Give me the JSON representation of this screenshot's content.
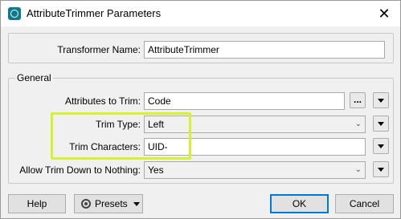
{
  "window": {
    "title": "AttributeTrimmer Parameters",
    "close_glyph": "✕"
  },
  "transformer": {
    "label": "Transformer Name:",
    "value": "AttributeTrimmer"
  },
  "general": {
    "legend": "General",
    "attributes_to_trim": {
      "label": "Attributes to Trim:",
      "value": "Code",
      "browse_label": "..."
    },
    "trim_type": {
      "label": "Trim Type:",
      "value": "Left"
    },
    "trim_characters": {
      "label": "Trim Characters:",
      "value": "UID-"
    },
    "allow_trim": {
      "label": "Allow Trim Down to Nothing:",
      "value": "Yes"
    }
  },
  "footer": {
    "help_label": "Help",
    "presets_label": "Presets",
    "ok_label": "OK",
    "cancel_label": "Cancel"
  },
  "colors": {
    "highlight": "#d9f02e",
    "app_icon": "#0b7a8f",
    "default_button_border": "#0078d7"
  },
  "icons": {
    "app": "fme-app-icon",
    "close": "close-icon",
    "gear": "gear-icon",
    "dropdown": "chevron-down-icon",
    "menu": "triangle-down-icon"
  }
}
